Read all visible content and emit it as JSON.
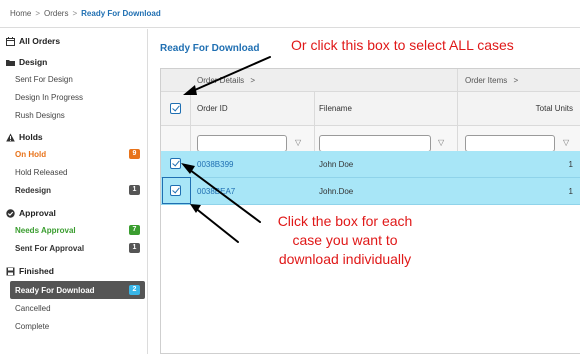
{
  "breadcrumb": {
    "home": "Home",
    "sep": ">",
    "orders": "Orders",
    "current": "Ready For Download"
  },
  "sidebar": {
    "all_orders": "All Orders",
    "design_head": "Design",
    "design_items": [
      "Sent For Design",
      "Design In Progress",
      "Rush Designs"
    ],
    "holds_head": "Holds",
    "on_hold": "On Hold",
    "on_hold_count": "9",
    "hold_released": "Hold Released",
    "redesign": "Redesign",
    "redesign_count": "1",
    "approval_head": "Approval",
    "needs_approval": "Needs Approval",
    "needs_approval_count": "7",
    "sent_for_approval": "Sent For Approval",
    "sent_for_approval_count": "1",
    "finished_head": "Finished",
    "ready_for_download": "Ready For Download",
    "ready_for_download_count": "2",
    "cancelled": "Cancelled",
    "complete": "Complete"
  },
  "main": {
    "title": "Ready For Download",
    "group_order_details": "Order Details",
    "group_order_items": "Order Items",
    "group_chevron": ">",
    "col_order_id": "Order ID",
    "col_filename": "Filename",
    "col_total_units": "Total Units",
    "filter_icon": "▽",
    "rows": [
      {
        "order_id": "0038B399",
        "filename": "John Doe",
        "units": "1"
      },
      {
        "order_id": "0038BEA7",
        "filename": "John.Doe",
        "units": "1"
      }
    ]
  },
  "annotations": {
    "select_all": "Or click this box to select ALL cases",
    "individual_line1": "Click the box for each",
    "individual_line2": "case you want to",
    "individual_line3": "download individually"
  },
  "colors": {
    "accent": "#1f6fb2",
    "selected_row": "#a8e6f7",
    "annotation": "#e01818",
    "orange": "#e8731a",
    "green": "#3a9d2f",
    "active_bg": "#555555",
    "badge_blue": "#38b6e8"
  },
  "icons": {
    "calendar": "calendar-icon",
    "folder": "folder-icon",
    "warning": "warning-icon",
    "check_circle": "check-circle-icon",
    "save": "save-icon",
    "filter": "filter-icon"
  }
}
